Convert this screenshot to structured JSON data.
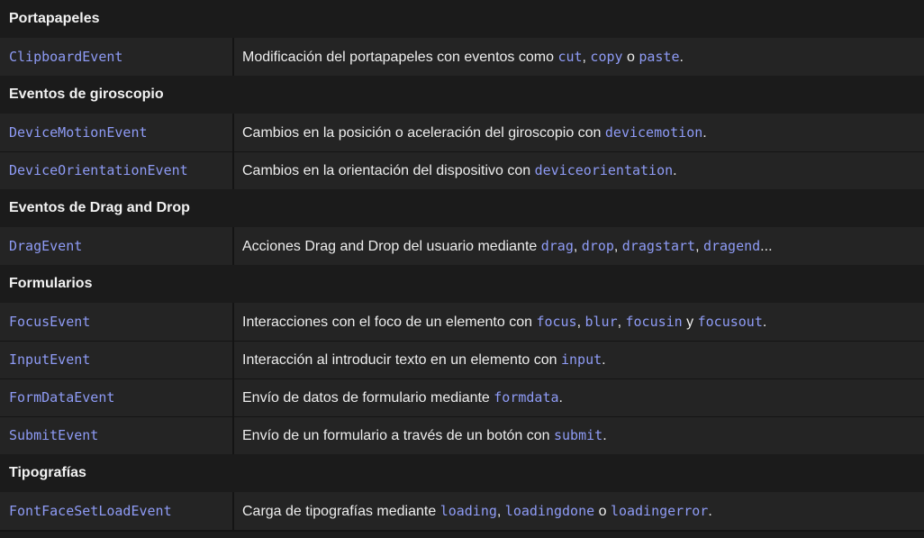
{
  "sections": [
    {
      "title": "Portapapeles",
      "rows": [
        {
          "name": "ClipboardEvent",
          "description": [
            {
              "text": "Modificación del portapapeles con eventos como "
            },
            {
              "code": "cut"
            },
            {
              "text": ", "
            },
            {
              "code": "copy"
            },
            {
              "text": " o "
            },
            {
              "code": "paste"
            },
            {
              "text": "."
            }
          ]
        }
      ]
    },
    {
      "title": "Eventos de giroscopio",
      "rows": [
        {
          "name": "DeviceMotionEvent",
          "description": [
            {
              "text": "Cambios en la posición o aceleración del giroscopio con "
            },
            {
              "code": "devicemotion"
            },
            {
              "text": "."
            }
          ]
        },
        {
          "name": "DeviceOrientationEvent",
          "description": [
            {
              "text": "Cambios en la orientación del dispositivo con "
            },
            {
              "code": "deviceorientation"
            },
            {
              "text": "."
            }
          ]
        }
      ]
    },
    {
      "title": "Eventos de Drag and Drop",
      "rows": [
        {
          "name": "DragEvent",
          "description": [
            {
              "text": "Acciones Drag and Drop del usuario mediante "
            },
            {
              "code": "drag"
            },
            {
              "text": ", "
            },
            {
              "code": "drop"
            },
            {
              "text": ", "
            },
            {
              "code": "dragstart"
            },
            {
              "text": ", "
            },
            {
              "code": "dragend"
            },
            {
              "text": "..."
            }
          ]
        }
      ]
    },
    {
      "title": "Formularios",
      "rows": [
        {
          "name": "FocusEvent",
          "description": [
            {
              "text": "Interacciones con el foco de un elemento con "
            },
            {
              "code": "focus"
            },
            {
              "text": ", "
            },
            {
              "code": "blur"
            },
            {
              "text": ", "
            },
            {
              "code": "focusin"
            },
            {
              "text": " y "
            },
            {
              "code": "focusout"
            },
            {
              "text": "."
            }
          ]
        },
        {
          "name": "InputEvent",
          "description": [
            {
              "text": "Interacción al introducir texto en un elemento con "
            },
            {
              "code": "input"
            },
            {
              "text": "."
            }
          ]
        },
        {
          "name": "FormDataEvent",
          "description": [
            {
              "text": "Envío de datos de formulario mediante "
            },
            {
              "code": "formdata"
            },
            {
              "text": "."
            }
          ]
        },
        {
          "name": "SubmitEvent",
          "description": [
            {
              "text": "Envío de un formulario a través de un botón con "
            },
            {
              "code": "submit"
            },
            {
              "text": "."
            }
          ]
        }
      ]
    },
    {
      "title": "Tipografías",
      "rows": [
        {
          "name": "FontFaceSetLoadEvent",
          "description": [
            {
              "text": "Carga de tipografías mediante "
            },
            {
              "code": "loading"
            },
            {
              "text": ", "
            },
            {
              "code": "loadingdone"
            },
            {
              "text": " o "
            },
            {
              "code": "loadingerror"
            },
            {
              "text": "."
            }
          ]
        }
      ]
    }
  ]
}
